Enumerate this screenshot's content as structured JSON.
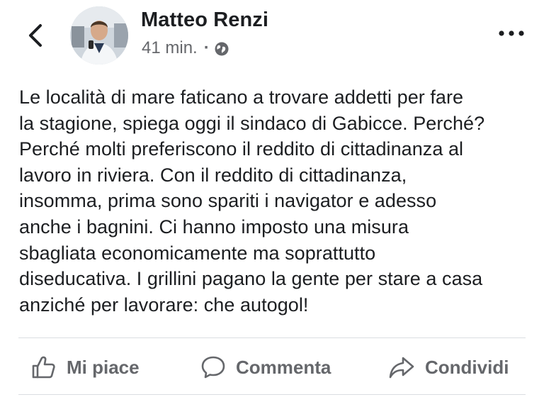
{
  "header": {
    "author_name": "Matteo Renzi",
    "timestamp": "41 min.",
    "separator": "·",
    "back_icon": "chevron-left-icon",
    "privacy_icon": "globe-icon",
    "more_icon": "more-horizontal-icon"
  },
  "post": {
    "text": "Le località di mare faticano a trovare addetti per fare\nla stagione, spiega oggi il sindaco di Gabicce. Perché?\nPerché molti preferiscono il reddito di cittadinanza al\nlavoro in riviera. Con il reddito di cittadinanza,\ninsomma, prima sono spariti i navigator e adesso\nanche i bagnini. Ci hanno imposto una misura\nsbagliata economicamente ma soprattutto\ndiseducativa. I grillini pagano la gente per stare a casa\nanziché per lavorare: che autogol!"
  },
  "actions": {
    "like_label": "Mi piace",
    "comment_label": "Commenta",
    "share_label": "Condividi",
    "like_icon": "thumbs-up-icon",
    "comment_icon": "comment-bubble-icon",
    "share_icon": "share-arrow-icon"
  },
  "colors": {
    "text_primary": "#1c1e21",
    "text_secondary": "#65676b",
    "divider": "#dadde1",
    "background": "#ffffff"
  }
}
